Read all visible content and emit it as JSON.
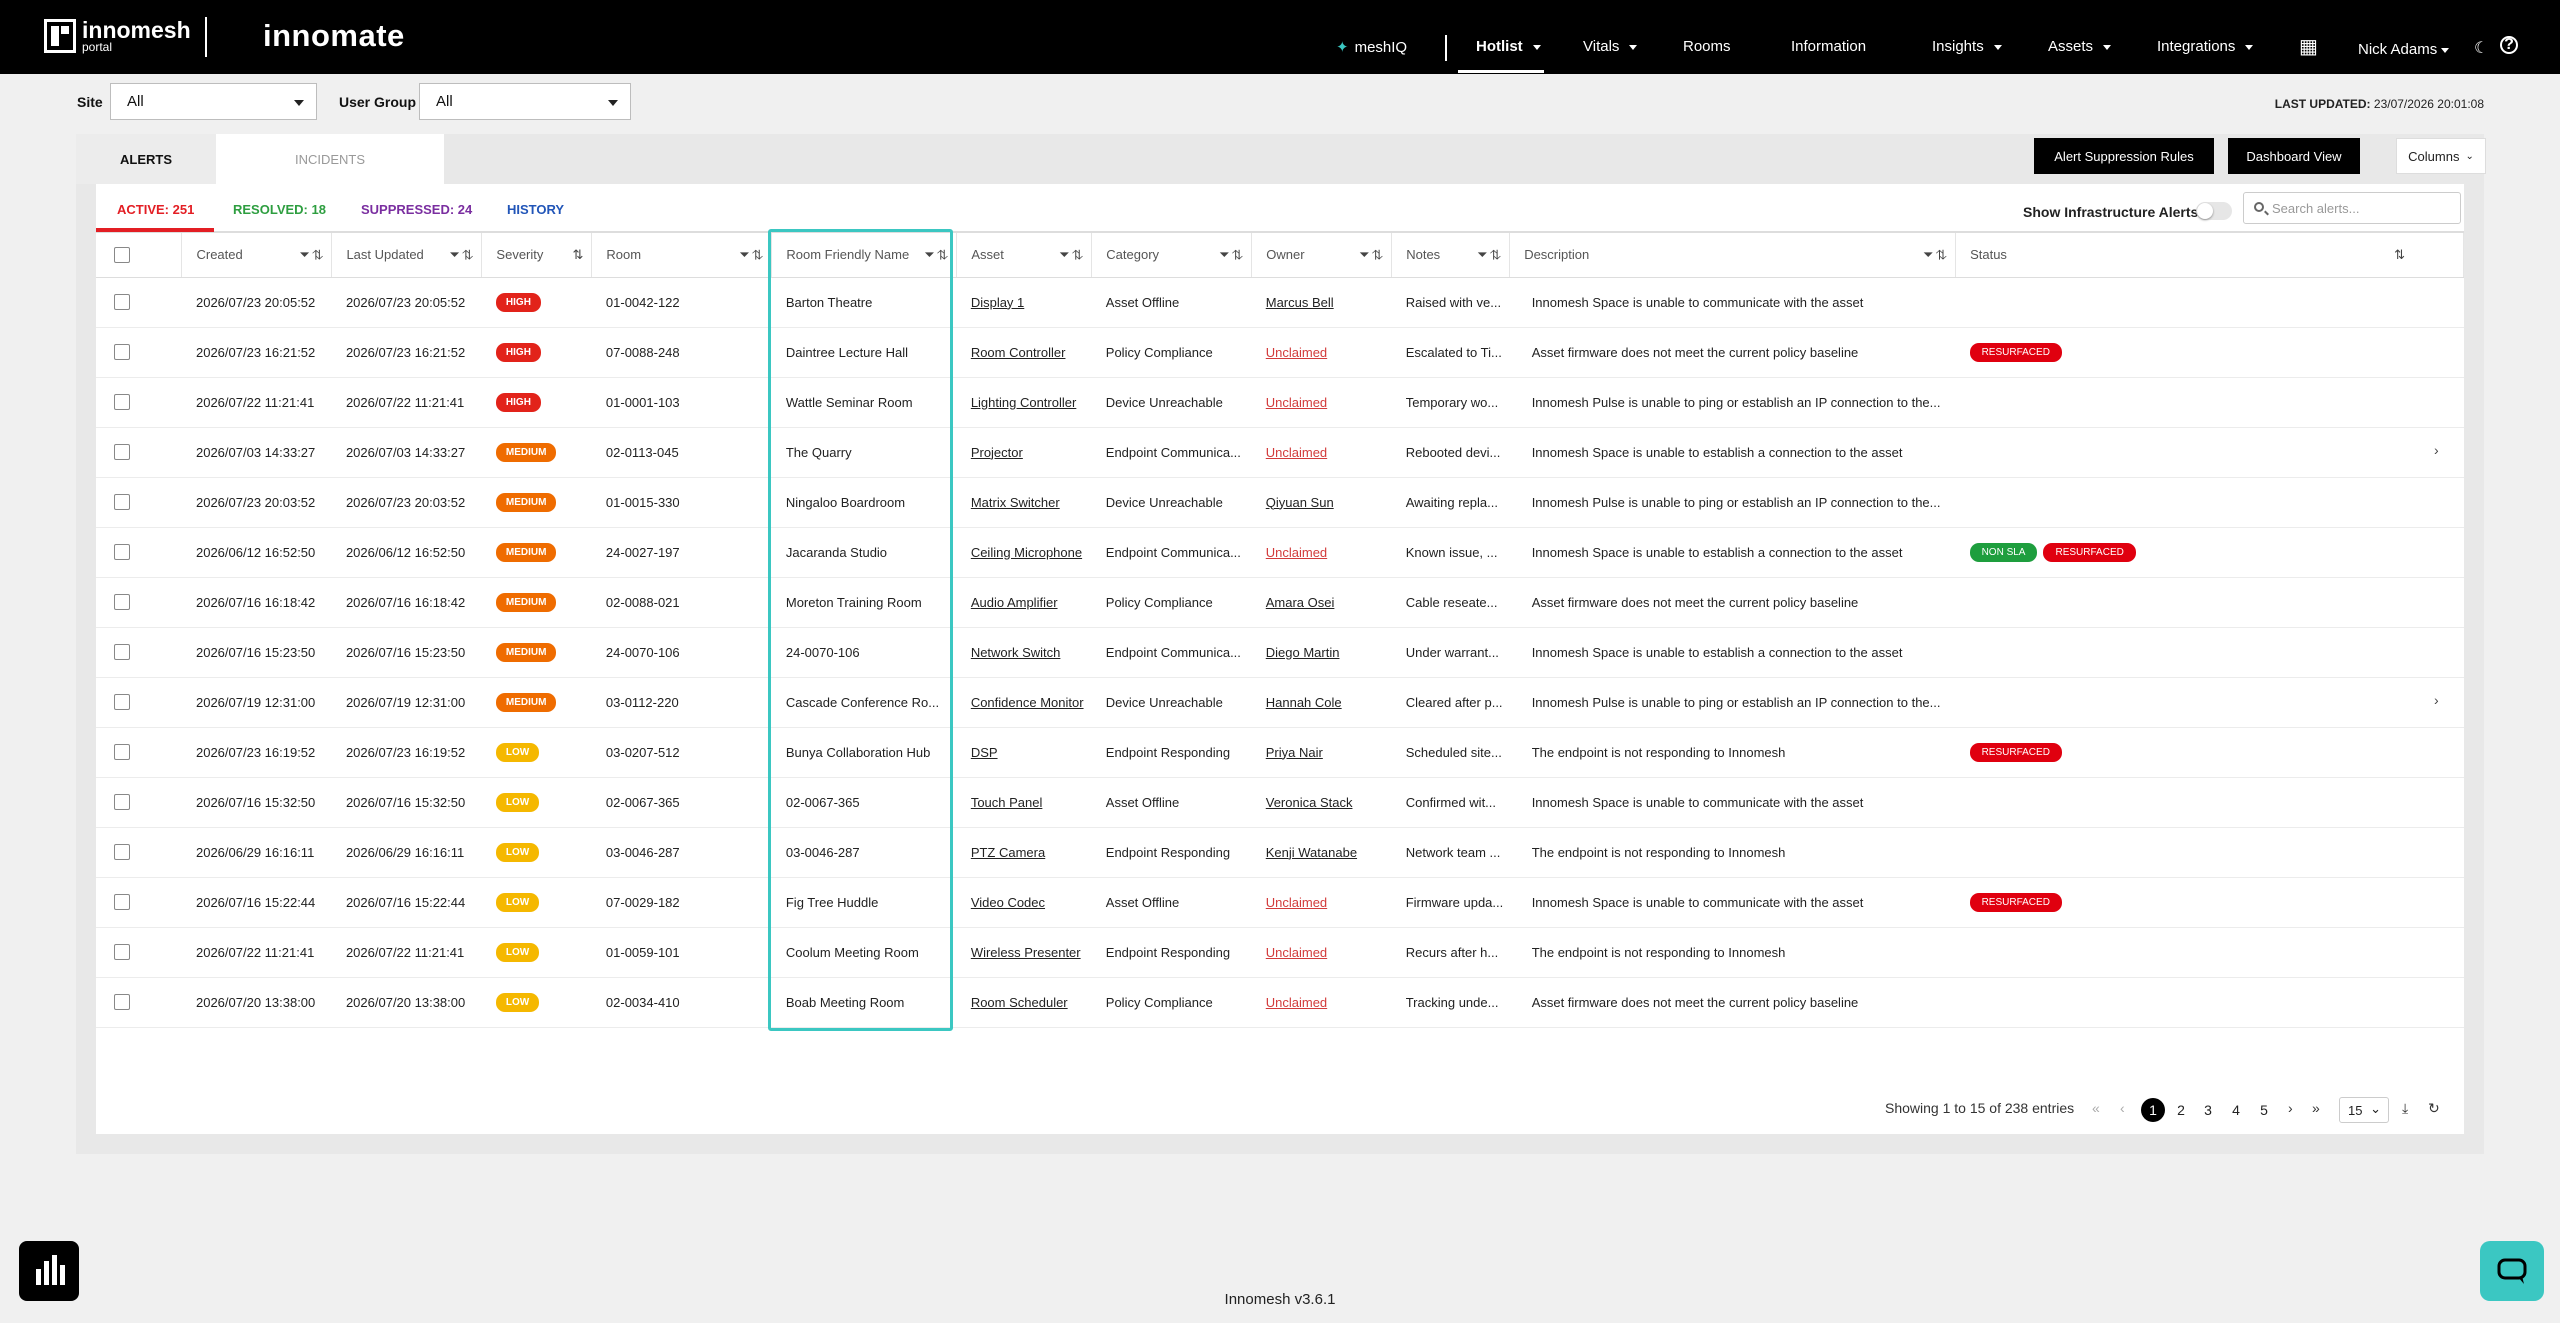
{
  "nav": {
    "brand_main": "innomesh",
    "brand_sub": "portal",
    "brand2": "innomate",
    "items": [
      "meshIQ",
      "Hotlist",
      "Vitals",
      "Rooms",
      "Information",
      "Insights",
      "Assets",
      "Integrations"
    ],
    "user": "Nick Adams"
  },
  "filters": {
    "site_label": "Site",
    "site_value": "All",
    "group_label": "User Group",
    "group_value": "All",
    "last_updated_label": "LAST UPDATED:",
    "last_updated_value": "23/07/2026 20:01:08"
  },
  "tabs": [
    "ALERTS",
    "INCIDENTS"
  ],
  "buttons": {
    "suppression": "Alert Suppression Rules",
    "dashboard": "Dashboard View",
    "columns": "Columns"
  },
  "subtabs": {
    "active": "ACTIVE: 251",
    "resolved": "RESOLVED: 18",
    "suppressed": "SUPPRESSED: 24",
    "history": "HISTORY"
  },
  "toggle_label": "Show Infrastructure Alerts",
  "search_placeholder": "Search alerts...",
  "columns": [
    "Created",
    "Last Updated",
    "Severity",
    "Room",
    "Room Friendly Name",
    "Asset",
    "Category",
    "Owner",
    "Notes",
    "Description",
    "Status"
  ],
  "rows": [
    {
      "created": "2026/07/23 20:05:52",
      "updated": "2026/07/23 20:05:52",
      "severity": "HIGH",
      "room": "01-0042-122",
      "friendly": "Barton Theatre",
      "asset": "Display 1",
      "category": "Asset Offline",
      "owner": "Marcus Bell",
      "notes": "Raised with ve...",
      "description": "Innomesh Space is unable to communicate with the asset",
      "status": []
    },
    {
      "created": "2026/07/23 16:21:52",
      "updated": "2026/07/23 16:21:52",
      "severity": "HIGH",
      "room": "07-0088-248",
      "friendly": "Daintree Lecture Hall",
      "asset": "Room Controller",
      "category": "Policy Compliance",
      "owner": "Unclaimed",
      "notes": "Escalated to Ti...",
      "description": "Asset firmware does not meet the current policy baseline",
      "status": [
        "RESURFACED"
      ]
    },
    {
      "created": "2026/07/22 11:21:41",
      "updated": "2026/07/22 11:21:41",
      "severity": "HIGH",
      "room": "01-0001-103",
      "friendly": "Wattle Seminar Room",
      "asset": "Lighting Controller",
      "category": "Device Unreachable",
      "owner": "Unclaimed",
      "notes": "Temporary wo...",
      "description": "Innomesh Pulse is unable to ping or establish an IP connection to the...",
      "status": []
    },
    {
      "created": "2026/07/03 14:33:27",
      "updated": "2026/07/03 14:33:27",
      "severity": "MEDIUM",
      "room": "02-0113-045",
      "friendly": "The Quarry",
      "asset": "Projector",
      "category": "Endpoint Communica...",
      "owner": "Unclaimed",
      "notes": "Rebooted devi...",
      "description": "Innomesh Space is unable to establish a connection to the asset",
      "status": []
    },
    {
      "created": "2026/07/23 20:03:52",
      "updated": "2026/07/23 20:03:52",
      "severity": "MEDIUM",
      "room": "01-0015-330",
      "friendly": "Ningaloo Boardroom",
      "asset": "Matrix Switcher",
      "category": "Device Unreachable",
      "owner": "Qiyuan Sun",
      "notes": "Awaiting repla...",
      "description": "Innomesh Pulse is unable to ping or establish an IP connection to the...",
      "status": []
    },
    {
      "created": "2026/06/12 16:52:50",
      "updated": "2026/06/12 16:52:50",
      "severity": "MEDIUM",
      "room": "24-0027-197",
      "friendly": "Jacaranda Studio",
      "asset": "Ceiling Microphone",
      "category": "Endpoint Communica...",
      "owner": "Unclaimed",
      "notes": "Known issue, ...",
      "description": "Innomesh Space is unable to establish a connection to the asset",
      "status": [
        "NON SLA",
        "RESURFACED"
      ]
    },
    {
      "created": "2026/07/16 16:18:42",
      "updated": "2026/07/16 16:18:42",
      "severity": "MEDIUM",
      "room": "02-0088-021",
      "friendly": "Moreton Training Room",
      "asset": "Audio Amplifier",
      "category": "Policy Compliance",
      "owner": "Amara Osei",
      "notes": "Cable reseate...",
      "description": "Asset firmware does not meet the current policy baseline",
      "status": []
    },
    {
      "created": "2026/07/16 15:23:50",
      "updated": "2026/07/16 15:23:50",
      "severity": "MEDIUM",
      "room": "24-0070-106",
      "friendly": "24-0070-106",
      "asset": "Network Switch",
      "category": "Endpoint Communica...",
      "owner": "Diego Martin",
      "notes": "Under warrant...",
      "description": "Innomesh Space is unable to establish a connection to the asset",
      "status": []
    },
    {
      "created": "2026/07/19 12:31:00",
      "updated": "2026/07/19 12:31:00",
      "severity": "MEDIUM",
      "room": "03-0112-220",
      "friendly": "Cascade Conference Ro...",
      "asset": "Confidence Monitor",
      "category": "Device Unreachable",
      "owner": "Hannah Cole",
      "notes": "Cleared after p...",
      "description": "Innomesh Pulse is unable to ping or establish an IP connection to the...",
      "status": []
    },
    {
      "created": "2026/07/23 16:19:52",
      "updated": "2026/07/23 16:19:52",
      "severity": "LOW",
      "room": "03-0207-512",
      "friendly": "Bunya Collaboration Hub",
      "asset": "DSP",
      "category": "Endpoint Responding",
      "owner": "Priya Nair",
      "notes": "Scheduled site...",
      "description": "The endpoint is not responding to Innomesh",
      "status": [
        "RESURFACED"
      ]
    },
    {
      "created": "2026/07/16 15:32:50",
      "updated": "2026/07/16 15:32:50",
      "severity": "LOW",
      "room": "02-0067-365",
      "friendly": "02-0067-365",
      "asset": "Touch Panel",
      "category": "Asset Offline",
      "owner": "Veronica Stack",
      "notes": "Confirmed wit...",
      "description": "Innomesh Space is unable to communicate with the asset",
      "status": []
    },
    {
      "created": "2026/06/29 16:16:11",
      "updated": "2026/06/29 16:16:11",
      "severity": "LOW",
      "room": "03-0046-287",
      "friendly": "03-0046-287",
      "asset": "PTZ Camera",
      "category": "Endpoint Responding",
      "owner": "Kenji Watanabe",
      "notes": "Network team ...",
      "description": "The endpoint is not responding to Innomesh",
      "status": []
    },
    {
      "created": "2026/07/16 15:22:44",
      "updated": "2026/07/16 15:22:44",
      "severity": "LOW",
      "room": "07-0029-182",
      "friendly": "Fig Tree Huddle",
      "asset": "Video Codec",
      "category": "Asset Offline",
      "owner": "Unclaimed",
      "notes": "Firmware upda...",
      "description": "Innomesh Space is unable to communicate with the asset",
      "status": [
        "RESURFACED"
      ]
    },
    {
      "created": "2026/07/22 11:21:41",
      "updated": "2026/07/22 11:21:41",
      "severity": "LOW",
      "room": "01-0059-101",
      "friendly": "Coolum Meeting Room",
      "asset": "Wireless Presenter",
      "category": "Endpoint Responding",
      "owner": "Unclaimed",
      "notes": "Recurs after h...",
      "description": "The endpoint is not responding to Innomesh",
      "status": []
    },
    {
      "created": "2026/07/20 13:38:00",
      "updated": "2026/07/20 13:38:00",
      "severity": "LOW",
      "room": "02-0034-410",
      "friendly": "Boab Meeting Room",
      "asset": "Room Scheduler",
      "category": "Policy Compliance",
      "owner": "Unclaimed",
      "notes": "Tracking unde...",
      "description": "Asset firmware does not meet the current policy baseline",
      "status": []
    }
  ],
  "pagination": {
    "summary": "Showing 1 to 15 of 238 entries",
    "pages": [
      "1",
      "2",
      "3",
      "4",
      "5"
    ],
    "page_size": "15"
  },
  "footer": "Innomesh v3.6.1",
  "colors": {
    "accent": "#3bc7c2",
    "high": "#e2231a",
    "medium": "#ef6c00",
    "low": "#f5b800"
  }
}
